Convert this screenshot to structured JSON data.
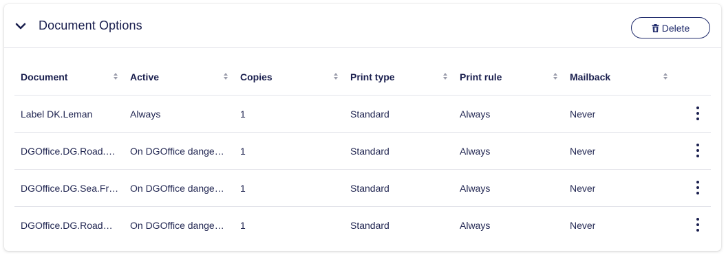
{
  "panel": {
    "title": "Document Options",
    "collapse_icon": "chevron-down-icon",
    "delete_label": "Delete",
    "delete_icon": "trash-icon"
  },
  "table": {
    "columns": [
      "Document",
      "Active",
      "Copies",
      "Print type",
      "Print rule",
      "Mailback"
    ],
    "rows": [
      {
        "document": "Label DK.Leman",
        "active": "Always",
        "copies": "1",
        "print_type": "Standard",
        "print_rule": "Always",
        "mailback": "Never"
      },
      {
        "document": "DGOffice.DG.Road.F…",
        "active": "On DGOffice dange…",
        "copies": "1",
        "print_type": "Standard",
        "print_rule": "Always",
        "mailback": "Never"
      },
      {
        "document": "DGOffice.DG.Sea.Fr…",
        "active": "On DGOffice dange…",
        "copies": "1",
        "print_type": "Standard",
        "print_rule": "Always",
        "mailback": "Never"
      },
      {
        "document": "DGOffice.DG.RoadU…",
        "active": "On DGOffice dange…",
        "copies": "1",
        "print_type": "Standard",
        "print_rule": "Always",
        "mailback": "Never"
      }
    ],
    "row_menu_icon": "more-vertical-icon",
    "sort_icon": "sort-icon"
  },
  "colors": {
    "text": "#1f2450",
    "accent": "#1f2a6b",
    "border": "#e3e4ea",
    "sort_icon": "#9a9cab"
  }
}
